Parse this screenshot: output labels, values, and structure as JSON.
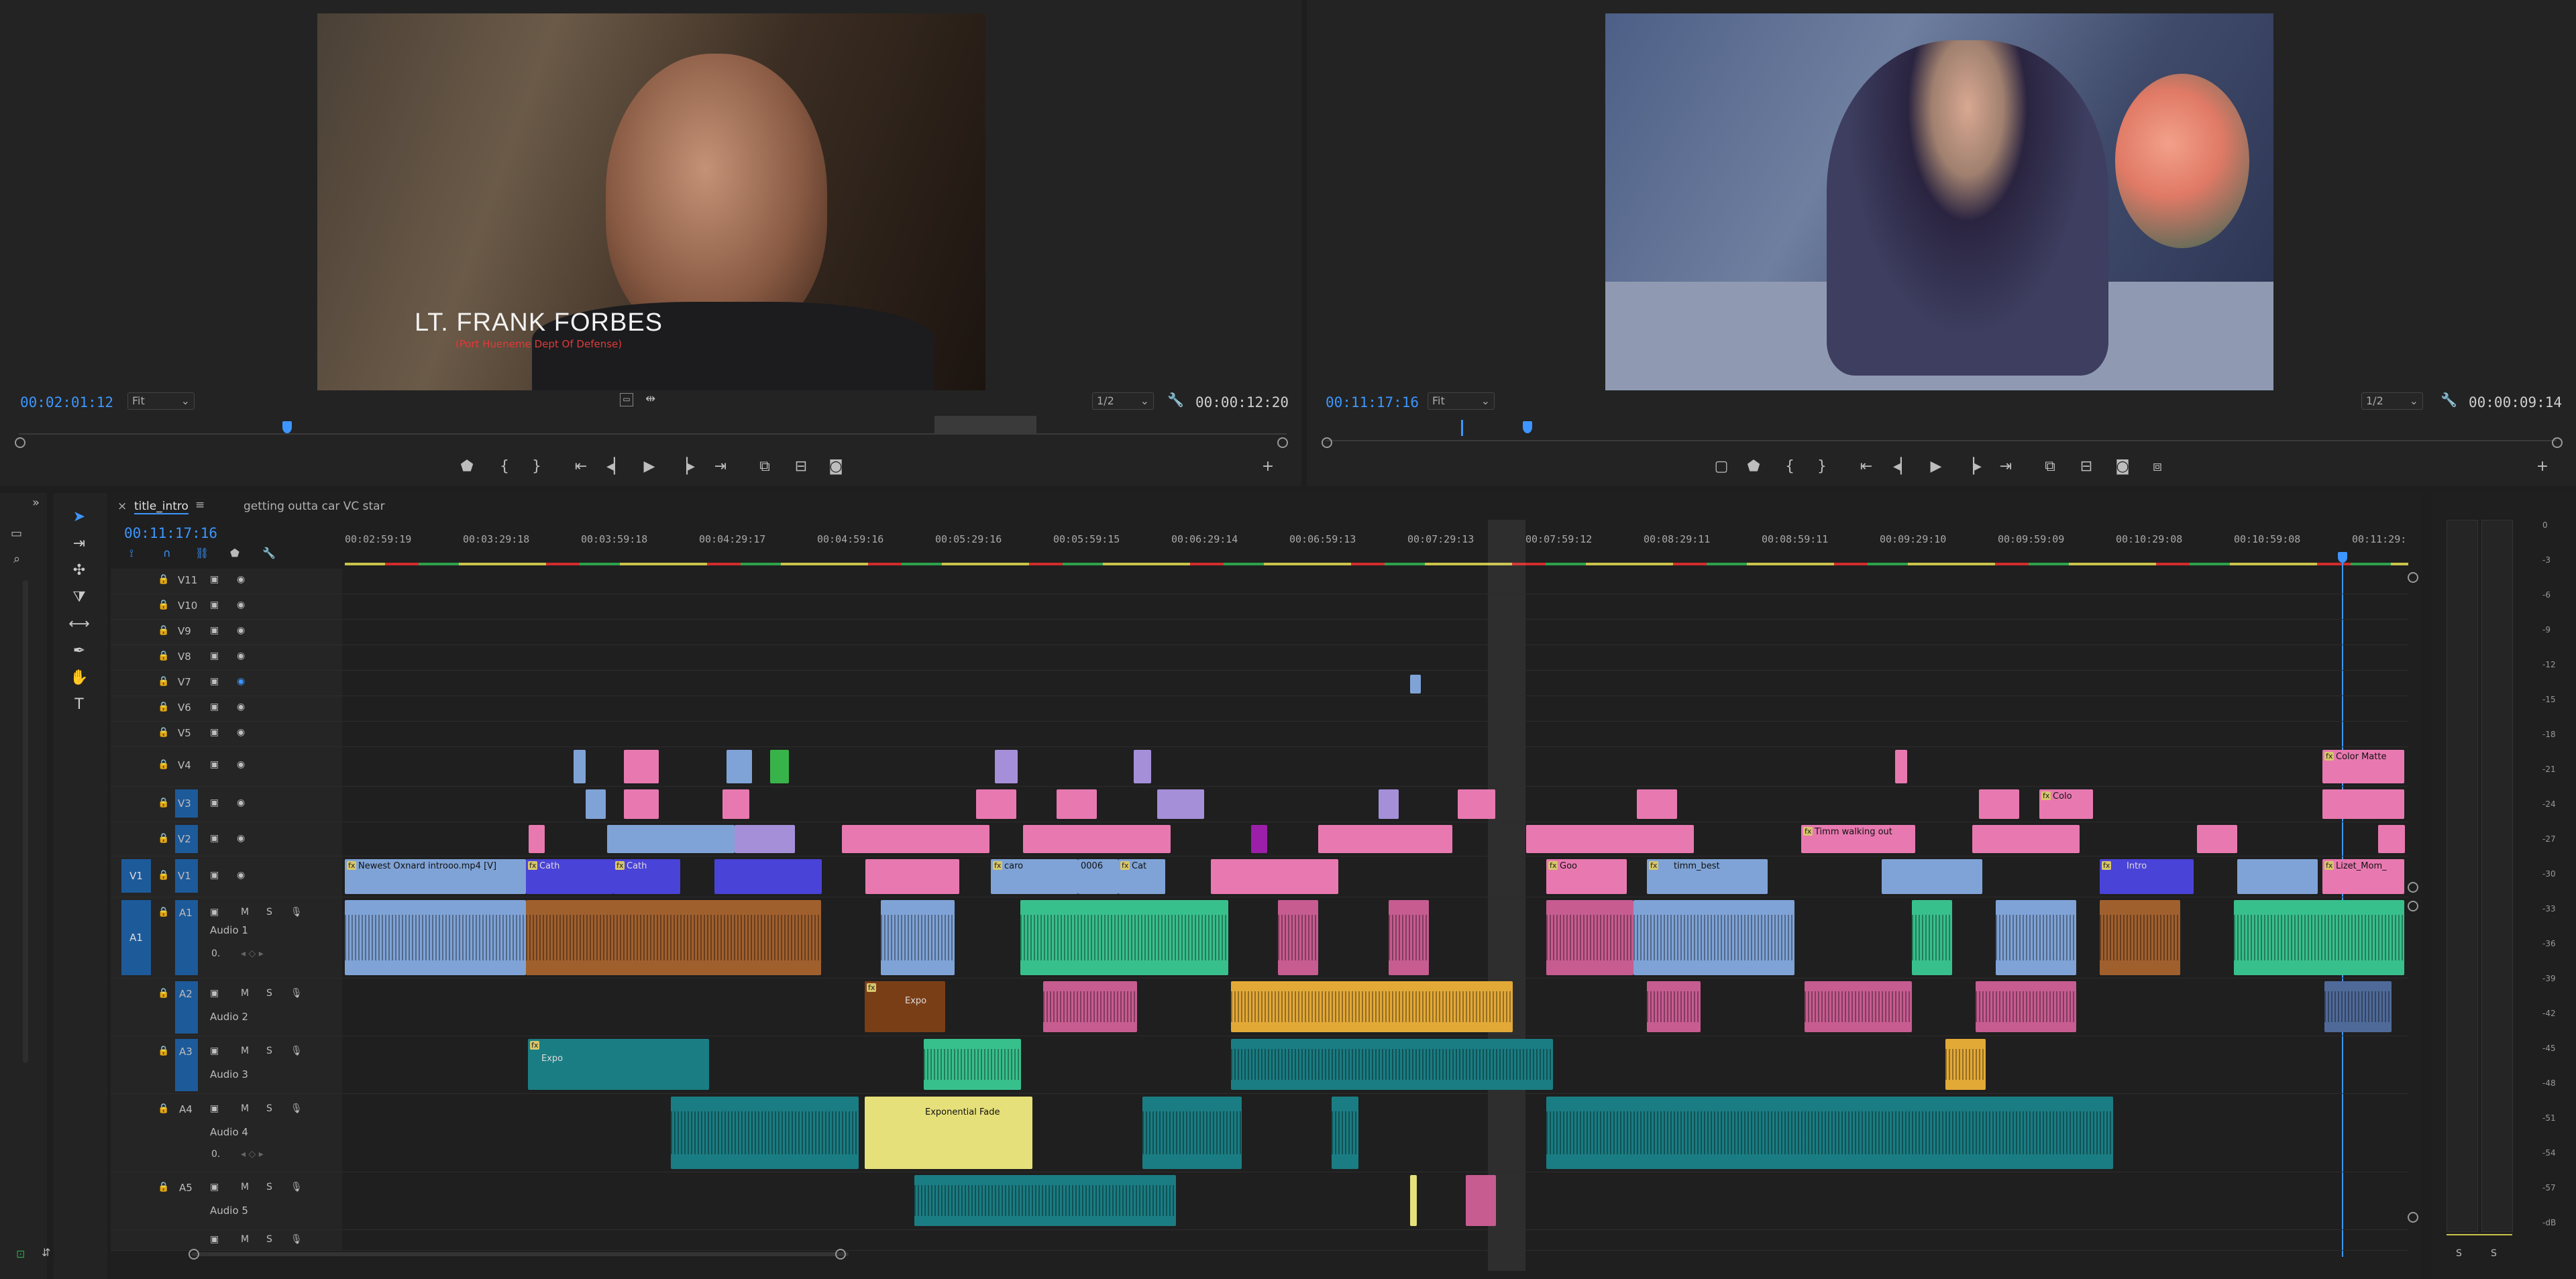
{
  "source_monitor": {
    "timecode": "00:02:01:12",
    "zoom": "Fit",
    "resolution": "1/2",
    "duration": "00:00:12:20",
    "lower_third_name": "LT. FRANK FORBES",
    "lower_third_title": "(Port Hueneme Dept Of Defense)"
  },
  "program_monitor": {
    "timecode": "00:11:17:16",
    "zoom": "Fit",
    "resolution": "1/2",
    "duration": "00:00:09:14"
  },
  "timeline": {
    "tabs": [
      {
        "label": "title_intro",
        "active": true
      },
      {
        "label": "getting outta car VC star",
        "active": false
      }
    ],
    "timecode": "00:11:17:16",
    "ruler": [
      "00:02:59:19",
      "00:03:29:18",
      "00:03:59:18",
      "00:04:29:17",
      "00:04:59:16",
      "00:05:29:16",
      "00:05:59:15",
      "00:06:29:14",
      "00:06:59:13",
      "00:07:29:13",
      "00:07:59:12",
      "00:08:29:11",
      "00:08:59:11",
      "00:09:29:10",
      "00:09:59:09",
      "00:10:29:08",
      "00:10:59:08",
      "00:11:29:"
    ],
    "video_tracks": [
      "V11",
      "V10",
      "V9",
      "V8",
      "V7",
      "V6",
      "V5",
      "V4",
      "V3",
      "V2",
      "V1"
    ],
    "audio_tracks": [
      {
        "id": "A1",
        "name": "Audio 1"
      },
      {
        "id": "A2",
        "name": "Audio 2"
      },
      {
        "id": "A3",
        "name": "Audio 3"
      },
      {
        "id": "A4",
        "name": "Audio 4"
      },
      {
        "id": "A5",
        "name": "Audio 5"
      }
    ],
    "clip_labels": {
      "v1_main": "Newest Oxnard introoo.mp4 [V]",
      "v1_a": "Cath",
      "v1_b": "Cath",
      "v1_c": "caro",
      "v1_d": "0006",
      "v1_e": "Cat",
      "v1_f": "Goo",
      "v1_g": "timm_best",
      "v1_h": "Intro",
      "v1_i": "Lizet_Mom_",
      "v2_timm": "Timm walking out",
      "v3_colo": "Colo",
      "v4_color_matte": "Color Matte",
      "a2_expo": "Expo",
      "a3_expo": "Expo",
      "a4_fade": "Exponential Fade"
    }
  },
  "audio_meter": {
    "scale": [
      "0",
      "-3",
      "-6",
      "-9",
      "-12",
      "-15",
      "-18",
      "-21",
      "-24",
      "-27",
      "-30",
      "-33",
      "-36",
      "-39",
      "-42",
      "-45",
      "-48",
      "-51",
      "-54",
      "-57",
      "-dB"
    ],
    "solo_left": "S",
    "solo_right": "S"
  },
  "colors": {
    "accent_blue": "#3d96ff",
    "clip_blue": "#7fa3d6",
    "clip_pink": "#e879b0",
    "clip_violet": "#a58fd8",
    "clip_green": "#38c08c",
    "clip_orange": "#a0602e",
    "clip_teal": "#1a7d83",
    "clip_gold": "#e3a937"
  }
}
